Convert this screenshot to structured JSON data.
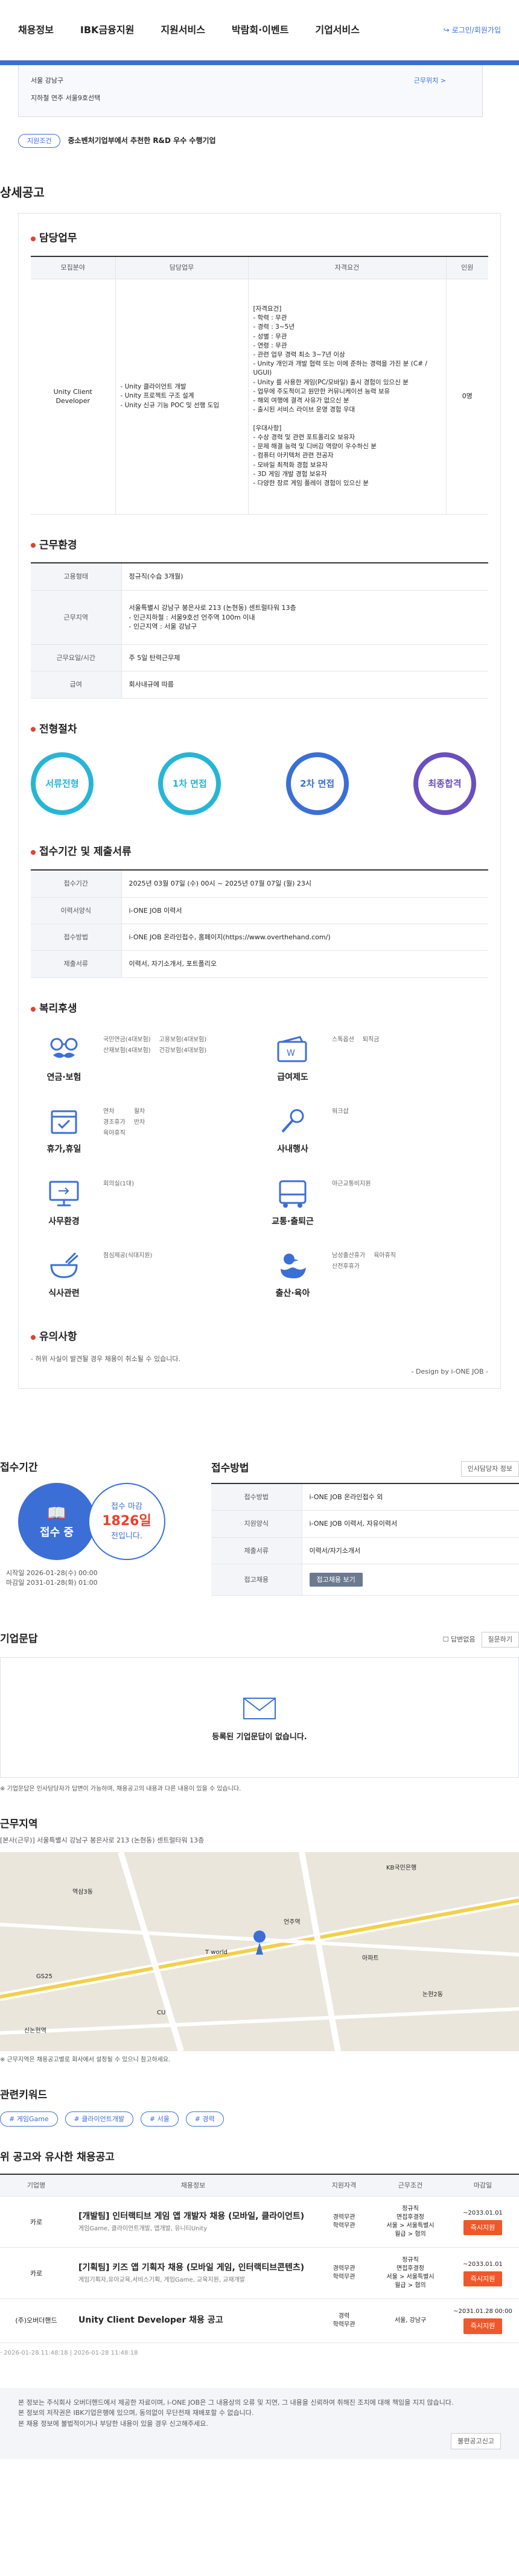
{
  "nav": {
    "items": [
      "채용정보",
      "IBK금융지원",
      "지원서비스",
      "박람회·이벤트",
      "기업서비스"
    ],
    "login": "로그인/회원가입"
  },
  "location_box": {
    "address": "서울 강남구",
    "note": "지하철 연주 서울9호선택",
    "more": "근무위치 >"
  },
  "sme_badge": {
    "pill": "지원조건",
    "text": "중소벤처기업부에서 추천한 R&D 우수 수행기업"
  },
  "detail": {
    "section_title": "상세공고",
    "duty": {
      "title": "담당업무",
      "headers": [
        "모집분야",
        "담당업무",
        "자격요건",
        "인원"
      ],
      "field": "Unity Client Developer",
      "tasks": "- Unity 클라이언트 개발\n- Unity 프로젝트 구조 설계\n- Unity 신규 기능 POC 및 선행 도입",
      "requirements": "[자격요건]\n- 학력 : 무관\n- 경력 : 3~5년\n- 성별 : 무관\n- 연령 : 무관\n- 관련 업무 경력 최소 3~7년 이상\n- Unity 개인과 개발 협력 또는 이에 준하는 경력을 가진 분 (C# / UGUI)\n- Unity 를 사용한 게임(PC/모바일) 출시 경험이 있으신 분\n- 업무에 주도적이고 원만한 커뮤니케이션 능력 보유\n- 해외 여행에 결격 사유가 없으신 분\n- 출시된 서비스 라이브 운영 경험 우대\n\n[우대사항]\n- 수상 경력 및 관련 포트폴리오 보유자\n- 문제 해결 능력 및 디버깅 역량이 우수하신 분\n- 컴퓨터 아키텍처 관련 전공자\n- 모바일 최적화 경험 보유자\n- 3D 게임 개발 경험 보유자\n- 다양한 장르 게임 플레이 경험이 있으신 분",
      "headcount": "0명"
    },
    "condition": {
      "title": "근무환경",
      "rows": [
        {
          "label": "고용형태",
          "value": "정규직(수습 3개월)"
        },
        {
          "label": "근무지역",
          "value": "서울특별시 강남구 봉은사로 213 (논현동) 센트럴타워 13층\n- 인근지하철 : 서울9호선 언주역 100m 이내\n- 인근지역 : 서울 강남구"
        },
        {
          "label": "근무요일/시간",
          "value": "주 5일 탄력근무제"
        },
        {
          "label": "급여",
          "value": "회사내규에 따름"
        }
      ]
    },
    "process": {
      "title": "전형절차",
      "steps": [
        "서류전형",
        "1차 면접",
        "2차 면접",
        "최종합격"
      ],
      "colors": [
        "#27b5d6",
        "#27b5d6",
        "#3b6fd6",
        "#6a4fbf"
      ]
    },
    "receipt": {
      "title": "접수기간 및 제출서류",
      "rows": [
        {
          "label": "접수기간",
          "value": "2025년 03월 07일 (수) 00시 ~ 2025년 07월 07일 (월) 23시"
        },
        {
          "label": "이력서양식",
          "value": "i-ONE JOB 이력서"
        },
        {
          "label": "접수방법",
          "value": "i-ONE JOB 온라인접수, 홈페이지(https://www.overthehand.com/)"
        },
        {
          "label": "제출서류",
          "value": "이력서, 자기소개서, 포트폴리오"
        }
      ]
    },
    "welfare": {
      "title": "복리후생",
      "categories": [
        {
          "label": "연금·보험",
          "icon": "glasses-mustache-icon",
          "items": [
            "국민연금(4대보험)",
            "고용보험(4대보험)",
            "산재보험(4대보험)",
            "건강보험(4대보험)"
          ]
        },
        {
          "label": "급여제도",
          "icon": "wallet-icon",
          "items": [
            "스톡옵션",
            "퇴직금"
          ]
        },
        {
          "label": "휴가,휴일",
          "icon": "calendar-icon",
          "items": [
            "연차",
            "월차",
            "경조휴가",
            "반차",
            "육아휴직"
          ]
        },
        {
          "label": "사내행사",
          "icon": "microphone-icon",
          "items": [
            "워크샵"
          ]
        },
        {
          "label": "사무환경",
          "icon": "monitor-icon",
          "items": [
            "회의실(1대)"
          ]
        },
        {
          "label": "교통·출퇴근",
          "icon": "bus-icon",
          "items": [
            "야근교통비지원"
          ]
        },
        {
          "label": "식사관련",
          "icon": "rice-bowl-icon",
          "items": [
            "점심제공(식대지원)"
          ]
        },
        {
          "label": "출산·육아",
          "icon": "duck-icon",
          "items": [
            "남성출산휴가",
            "육아휴직",
            "산전후휴가"
          ]
        }
      ]
    },
    "caution": {
      "title": "유의사항",
      "text": "- 허위 사실이 발견될 경우 채용이 취소될 수 있습니다.",
      "design": "- Design by i-ONE JOB -"
    }
  },
  "apply": {
    "period_title": "접수기간",
    "status": "접수 중",
    "dday_label": "접수 마감",
    "dday_value": "1826일",
    "dday_suffix": "전입니다.",
    "start": "시작일 2026-01-28(수) 00:00",
    "end": "마감일 2031-01-28(화) 01:00",
    "method_title": "접수방법",
    "method_btn": "인사담당자 정보",
    "rows": [
      {
        "label": "접수방법",
        "value": "i-ONE JOB 온라인접수 외"
      },
      {
        "label": "지원양식",
        "value": "i-ONE JOB 이력서, 자유이력서"
      },
      {
        "label": "제출서류",
        "value": "이력서/자기소개서"
      },
      {
        "label": "접고채용",
        "value": "접고채용 보기"
      }
    ]
  },
  "inquiry": {
    "title": "기업문답",
    "my_q": "답변없음",
    "sort": "질문하기",
    "empty": "등록된 기업문답이 없습니다.",
    "note": "※ 기업문답은 인사담당자가 답변이 가능하며, 채용공고의 내용과 다른 내용이 있을 수 있습니다."
  },
  "map_section": {
    "title": "근무지역",
    "address": "[본사(근무)] 서울특별시 강남구 봉은사로 213 (논현동) 센트럴타워 13층",
    "note": "※ 근무지역은 채용공고별로 회사에서 설정될 수 있으니 참고하세요.",
    "labels": [
      "KB국민은행",
      "역삼3동",
      "T world",
      "언주역",
      "논현2동",
      "GS25",
      "아파트",
      "CU",
      "신논현역"
    ]
  },
  "keywords": {
    "title": "관련키워드",
    "items": [
      "# 게임Game",
      "# 클라이언트개발",
      "# 서울",
      "# 경력"
    ]
  },
  "similar": {
    "title": "위 공고와 유사한 채용공고",
    "headers": [
      "기업명",
      "채용정보",
      "지원자격",
      "근무조건",
      "마감일"
    ],
    "rows": [
      {
        "company": "카로",
        "title": "[개발팀] 인터랙티브 게임 앱 개발자 채용 (모바일, 클라이언트)",
        "tags": "게임Game, 클라이언트개발, 앱개발, 유니티Unity",
        "qual": "경력무관\n학력무관",
        "cond": "정규직\n면접후결정\n서울 > 서울특별시\n월급 > 협의",
        "date": "~2033.01.01",
        "btn": "즉시지원"
      },
      {
        "company": "카로",
        "title": "[기획팀] 키즈 앱 기획자 채용 (모바일 게임, 인터랙티브콘텐츠)",
        "tags": "게임기획자,유아교육,서비스기획, 게임Game, 교육지원, 교재개발",
        "qual": "경력무관\n학력무관",
        "cond": "정규직\n면접후결정\n서울 > 서울특별시\n월급 > 협의",
        "date": "~2033.01.01",
        "btn": "즉시지원"
      },
      {
        "company": "(주)오버더핸드",
        "title": "Unity Client Developer 채용 공고",
        "tags": "",
        "qual": "경력\n학력무관",
        "cond": "서울, 강남구",
        "date": "~2031.01.28 00:00",
        "btn": "즉시지원"
      }
    ]
  },
  "meta": {
    "dates": "· 2026-01-28 11:48:18 | 2026-01-28 11:48:18"
  },
  "footer": {
    "lines": [
      "본 정보는 주식회사 오버더핸드에서 제공한 자료이며, i-ONE JOB은 그 내용상의 오류 및 지연, 그 내용을 신뢰하여 취해진 조치에 대해 책임을 지지 않습니다.",
      "본 정보의 저작권은 IBK기업은행에 있으며, 동의없이 무단전재 재배포할 수 없습니다.",
      "본 채용 정보에 불법적이거나 부당한 내용이 있을 경우 신고해주세요."
    ],
    "report_btn": "불편공고신고"
  }
}
